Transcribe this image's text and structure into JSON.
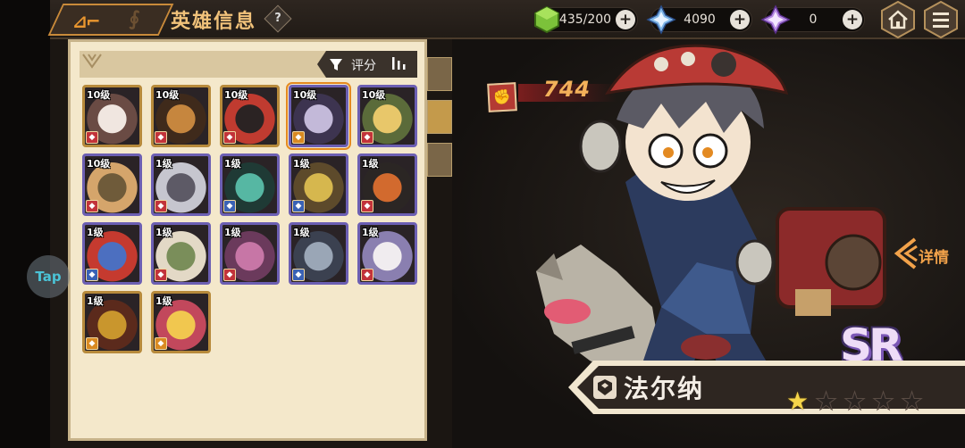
{
  "header": {
    "title": "英雄信息",
    "help_label": "?"
  },
  "resources": [
    {
      "name": "stamina",
      "icon": "green-cube-icon",
      "value": "435/200",
      "plus": "+"
    },
    {
      "name": "crystal",
      "icon": "blue-crystal-icon",
      "value": "4090",
      "plus": "+"
    },
    {
      "name": "premium",
      "icon": "purple-crystal-icon",
      "value": "0",
      "plus": "+"
    }
  ],
  "nav": {
    "home_icon": "home-icon",
    "menu_icon": "menu-icon"
  },
  "panel": {
    "sort_label": "评分",
    "filter_icon": "filter-icon",
    "sort_icon": "sort-bars-icon"
  },
  "heroes": [
    {
      "level": "10级",
      "frame": "gold",
      "cls": "red",
      "palette": [
        "#f0e6e0",
        "#6a4b44"
      ]
    },
    {
      "level": "10级",
      "frame": "gold",
      "cls": "red",
      "palette": [
        "#c6863e",
        "#3f2a1b"
      ]
    },
    {
      "level": "10级",
      "frame": "gold",
      "cls": "red",
      "palette": [
        "#2b2323",
        "#c03b30"
      ]
    },
    {
      "level": "10级",
      "frame": "purple",
      "cls": "orange",
      "palette": [
        "#c3b9d9",
        "#3d3450"
      ],
      "selected": true
    },
    {
      "level": "10级",
      "frame": "purple",
      "cls": "red",
      "palette": [
        "#e8c76a",
        "#5b6b3a"
      ]
    },
    {
      "level": "10级",
      "frame": "purple",
      "cls": "red",
      "palette": [
        "#6f5b3a",
        "#d5a56b"
      ]
    },
    {
      "level": "1级",
      "frame": "purple",
      "cls": "red",
      "palette": [
        "#5d5a66",
        "#c6c6cf"
      ]
    },
    {
      "level": "1级",
      "frame": "purple",
      "cls": "blue",
      "palette": [
        "#56b7a3",
        "#1f3a35"
      ]
    },
    {
      "level": "1级",
      "frame": "purple",
      "cls": "blue",
      "palette": [
        "#d6b74e",
        "#5d4a2b"
      ]
    },
    {
      "level": "1级",
      "frame": "purple",
      "cls": "red",
      "palette": [
        "#d26a2e",
        "#2b2624"
      ]
    },
    {
      "level": "1级",
      "frame": "purple",
      "cls": "blue",
      "palette": [
        "#4c6fc0",
        "#c53a2f"
      ]
    },
    {
      "level": "1级",
      "frame": "purple",
      "cls": "red",
      "palette": [
        "#7a8e5a",
        "#e3d9c6"
      ]
    },
    {
      "level": "1级",
      "frame": "purple",
      "cls": "red",
      "palette": [
        "#c776a6",
        "#6b3a5c"
      ]
    },
    {
      "level": "1级",
      "frame": "purple",
      "cls": "blue",
      "palette": [
        "#9aa6b6",
        "#3b4150"
      ]
    },
    {
      "level": "1级",
      "frame": "purple",
      "cls": "red",
      "palette": [
        "#f0ecef",
        "#8a7fb0"
      ]
    },
    {
      "level": "1级",
      "frame": "gold",
      "cls": "orange",
      "palette": [
        "#c9962d",
        "#5b2a1c"
      ]
    },
    {
      "level": "1级",
      "frame": "gold",
      "cls": "orange",
      "palette": [
        "#f1c74f",
        "#c2485c"
      ]
    }
  ],
  "selected_hero": {
    "power_icon": "fist-icon",
    "power": "744",
    "detail_label": "详情",
    "rarity": "SR",
    "name": "法尔纳",
    "stars_total": 5,
    "stars_filled": 1
  },
  "overlay": {
    "tap_label": "Tap"
  }
}
